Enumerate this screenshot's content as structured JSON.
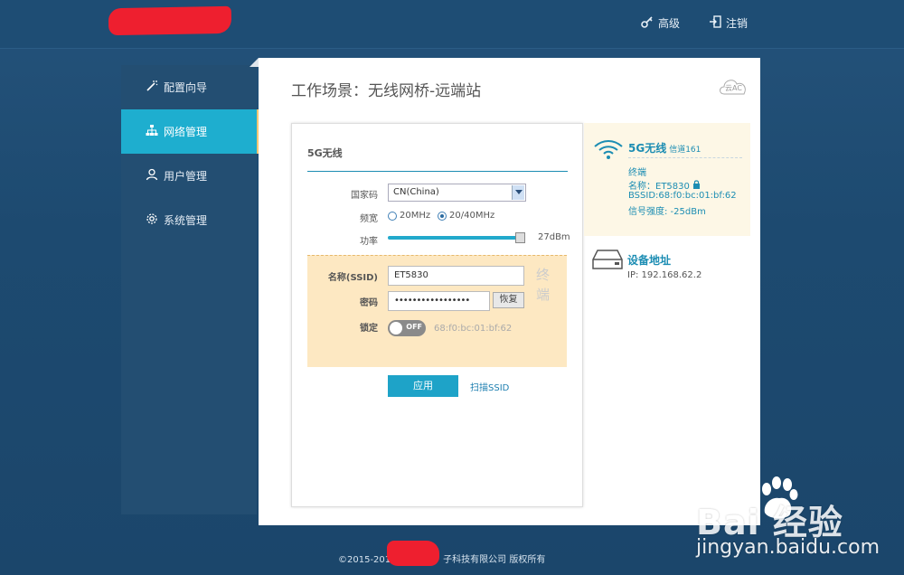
{
  "header": {
    "advanced_label": "高级",
    "logout_label": "注销"
  },
  "sidebar": {
    "items": [
      {
        "label": "配置向导",
        "icon": "wand-icon"
      },
      {
        "label": "网络管理",
        "icon": "network-icon",
        "active": true
      },
      {
        "label": "用户管理",
        "icon": "user-icon"
      },
      {
        "label": "系统管理",
        "icon": "gear-icon"
      }
    ]
  },
  "main": {
    "title": "工作场景：无线网桥-远端站",
    "cloud_label": "云AC"
  },
  "panel": {
    "title": "5G无线",
    "country_label": "国家码",
    "country_value": "CN(China)",
    "bandwidth_label": "频宽",
    "bandwidth_options": [
      "20MHz",
      "20/40MHz"
    ],
    "bandwidth_selected": "20/40MHz",
    "power_label": "功率",
    "power_value": "27dBm",
    "power_level_percent": 100,
    "client": {
      "ssid_label": "名称(SSID)",
      "ssid_value": "ET5830",
      "password_label": "密码",
      "password_value": "•••••••••••••••••",
      "restore_label": "恢复",
      "vertical_label_1": "终",
      "vertical_label_2": "端",
      "lock_label": "锁定",
      "lock_state": "OFF",
      "lock_mac": "68:f0:bc:01:bf:62"
    },
    "apply_label": "应用",
    "scan_label": "扫描SSID"
  },
  "info": {
    "title": "5G无线",
    "channel": "信道161",
    "mode": "终端",
    "name_line": "名称：ET5830",
    "bssid_line": "BSSID:68:f0:bc:01:bf:62",
    "signal_line": "信号强度: -25dBm"
  },
  "device": {
    "title": "设备地址",
    "ip_line": "IP: 192.168.62.2"
  },
  "footer": {
    "left": "©2015-201",
    "right": "子科技有限公司 版权所有"
  },
  "watermark": {
    "big": "Bai  经验",
    "small": "jingyan.baidu.com"
  },
  "colors": {
    "accent": "#1eaecf",
    "link": "#1c8db3",
    "highlight_bg": "#fde8c2"
  }
}
